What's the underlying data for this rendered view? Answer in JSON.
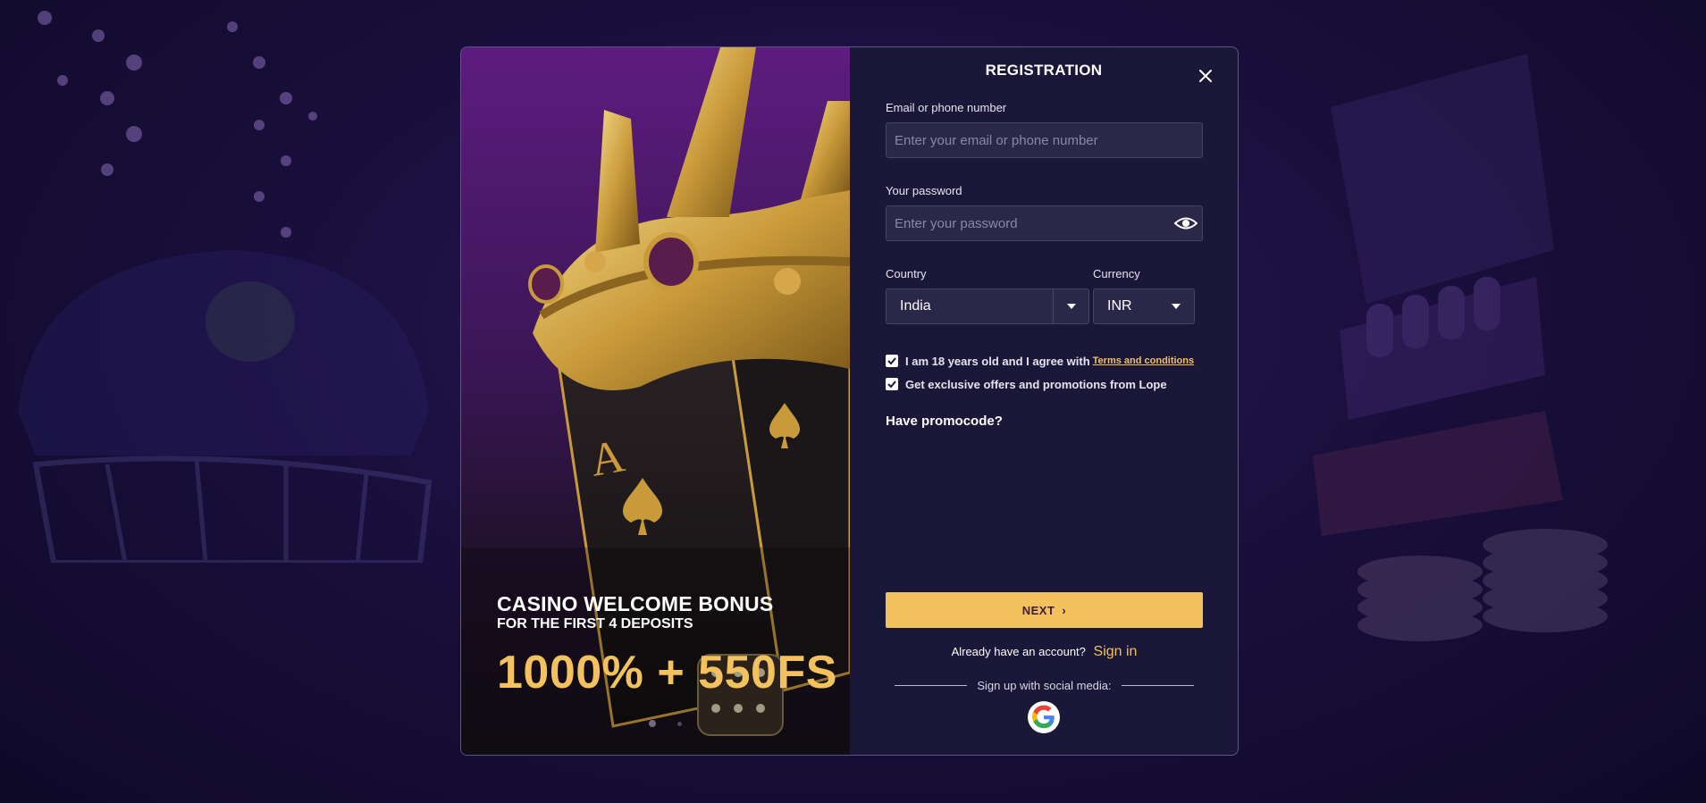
{
  "promo": {
    "title": "CASINO WELCOME BONUS",
    "subtitle": "FOR THE FIRST 4 DEPOSITS",
    "amount": "1000% + 550FS",
    "slides": 2,
    "active_slide": 1
  },
  "form": {
    "title": "REGISTRATION",
    "email": {
      "label": "Email or phone number",
      "placeholder": "Enter your email or phone number",
      "value": ""
    },
    "password": {
      "label": "Your password",
      "placeholder": "Enter your password",
      "value": ""
    },
    "country": {
      "label": "Country",
      "value": "India"
    },
    "currency": {
      "label": "Currency",
      "value": "INR"
    },
    "checkboxes": {
      "age": {
        "text": "I am 18 years old and I agree with",
        "link": "Terms and conditions",
        "checked": true
      },
      "offers": {
        "text": "Get exclusive offers and promotions from Lope",
        "checked": true
      }
    },
    "promocode_label": "Have promocode?",
    "next_label": "NEXT",
    "next_icon": "chevron-right-icon",
    "signin": {
      "text": "Already have an account?",
      "link": "Sign in"
    },
    "social": {
      "text": "Sign up with social media:",
      "providers": [
        "google-icon"
      ]
    }
  },
  "colors": {
    "accent": "#f3c15e",
    "panel": "#1a1738",
    "input_bg": "#2a2748"
  }
}
